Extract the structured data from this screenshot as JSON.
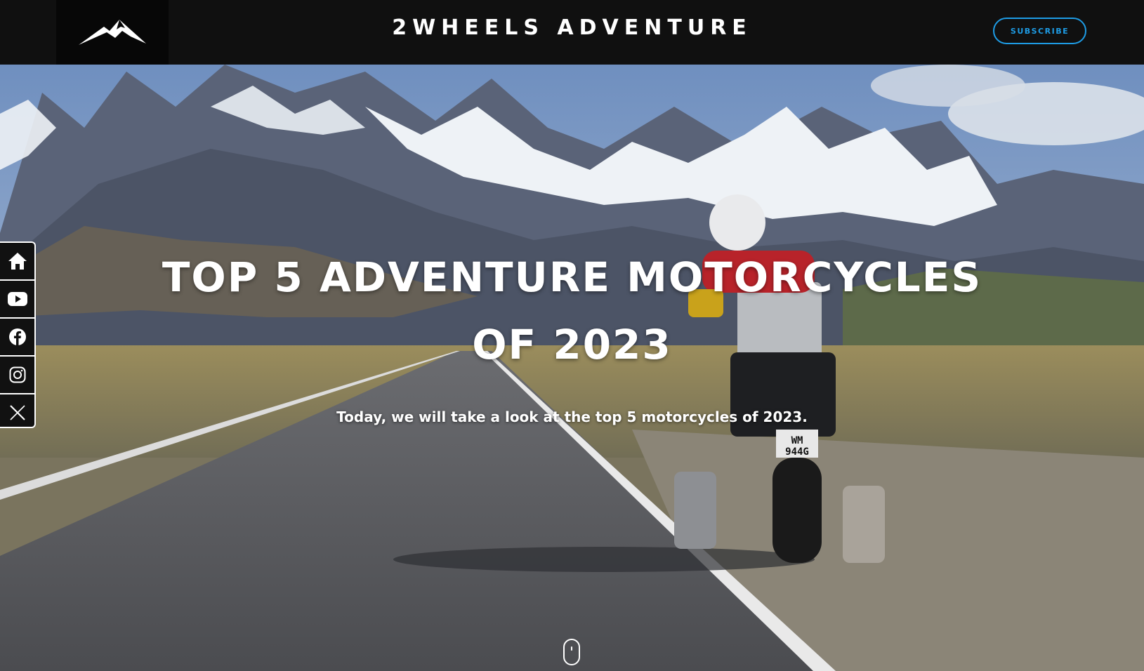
{
  "header": {
    "site_title": "2WHEELS ADVENTURE",
    "subscribe_label": "SUBSCRIBE",
    "logo_icon": "mountain-logo-icon"
  },
  "hero": {
    "title_line1": "TOP 5 ADVENTURE MOTORCYCLES",
    "title_line2": "OF 2023",
    "subtitle": "Today, we will take a look at the top 5 motorcycles of 2023."
  },
  "plate_text": [
    "WM",
    "944G"
  ],
  "social": {
    "items": [
      "home-icon",
      "youtube-icon",
      "facebook-icon",
      "instagram-icon",
      "x-icon"
    ]
  },
  "colors": {
    "accent": "#1e9ce5",
    "header_bg": "#101010"
  }
}
